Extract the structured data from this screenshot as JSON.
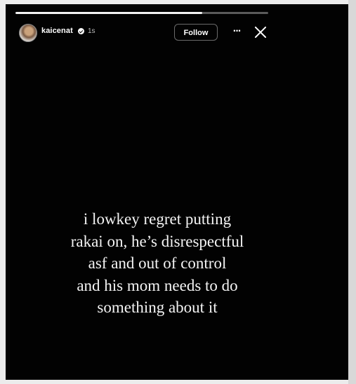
{
  "story": {
    "progress": 0.74,
    "username": "kaicenat",
    "verified": true,
    "time_ago": "1s",
    "follow_label": "Follow",
    "more_label": "···",
    "text_lines": [
      "i lowkey regret putting",
      "rakai on, he’s disrespectful",
      "asf and out of control",
      "and his mom needs to do",
      "something about it"
    ]
  },
  "icons": {
    "more": "more-options-icon",
    "close": "close-icon",
    "verified": "verified-badge-icon"
  },
  "colors": {
    "background": "#020202",
    "text": "#f4f4f4",
    "frame": "#ececec"
  }
}
